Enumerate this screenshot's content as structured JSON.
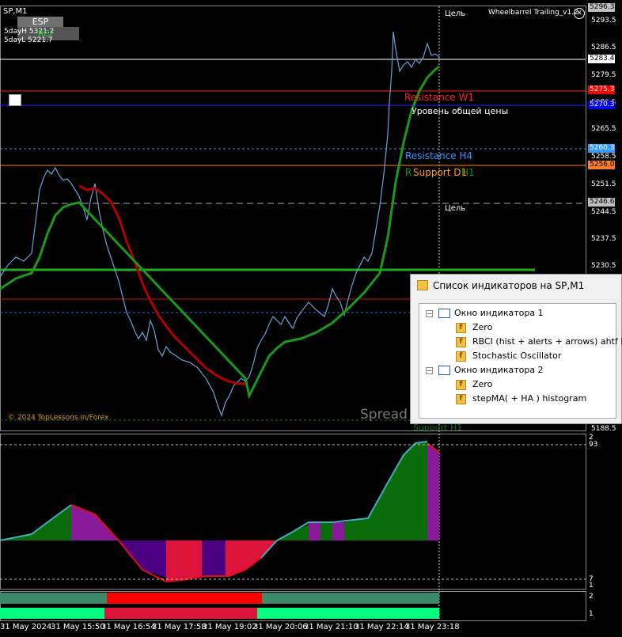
{
  "chart": {
    "symbol": "SP,M1",
    "indicator_name": "Wheelbarrel Trailing_v1.2",
    "day_high": "5dayH 5321.2",
    "day_low": "5dayL 5221.7",
    "esp_label": "ESP",
    "rci_label": "RCI",
    "watermark": "Spread",
    "copyright": "© 2024 TopLessons.In/Forex"
  },
  "levels": {
    "target_top": "Цель",
    "resistance_w1": "Resistance W1",
    "common_level": "Уровень общей цены",
    "resistance_h4": "Resistance H4",
    "support_d1": "Support D1",
    "r_h1_overlap": "R",
    "r_h1_suffix": "H1",
    "target_mid": "Цель",
    "support_h1": "Support H1"
  },
  "price_axis": {
    "ticks": [
      "5293.5",
      "5286.5",
      "5279.5",
      "5272.5",
      "5265.5",
      "5258.5",
      "5251.5",
      "5244.5",
      "5237.5",
      "5230.5",
      "5188.5"
    ],
    "tags": [
      {
        "text": "5296.3",
        "bg": "#c0c0c0",
        "fg": "#000000"
      },
      {
        "text": "5283.4",
        "bg": "#ffffff",
        "fg": "#000000"
      },
      {
        "text": "5275.3",
        "bg": "#ff0000",
        "fg": "#ffffff"
      },
      {
        "text": "5270.3",
        "bg": "#0000ff",
        "fg": "#ffffff"
      },
      {
        "text": "5260.3",
        "bg": "#3399ff",
        "fg": "#ffffff"
      },
      {
        "text": "5256.0",
        "bg": "#ff7f27",
        "fg": "#000000"
      },
      {
        "text": "5246.6",
        "bg": "#c0c0c0",
        "fg": "#000000"
      }
    ]
  },
  "sub1_axis": {
    "top": "2",
    "top2": "93",
    "bottom2": "7",
    "bottom": "1"
  },
  "sub2_axis": {
    "top": "2",
    "bottom": "1"
  },
  "time_axis": [
    "31 May 2024",
    "31 May 15:50",
    "31 May 16:54",
    "31 May 17:58",
    "31 May 19:02",
    "31 May 20:06",
    "31 May 21:10",
    "31 May 22:14",
    "31 May 23:18"
  ],
  "dialog": {
    "title": "Список индикаторов на SP,M1",
    "items": [
      {
        "label": "Окно индикатора 1",
        "type": "window"
      },
      {
        "label": "Zero",
        "type": "indicator"
      },
      {
        "label": "RBCI (hist + alerts + arrows) ahtf BT",
        "type": "indicator"
      },
      {
        "label": "Stochastic Oscillator",
        "type": "indicator"
      },
      {
        "label": "Окно индикатора 2",
        "type": "window"
      },
      {
        "label": "Zero",
        "type": "indicator"
      },
      {
        "label": "stepMA( + HA ) histogram",
        "type": "indicator"
      }
    ]
  },
  "colors": {
    "background": "#000000",
    "price_line": "#6f9fd8",
    "ma_red": "#b00000",
    "ma_green": "#1a9a1a",
    "resistance": "#ff0000",
    "support": "#228b22",
    "histo_green": "#0a6b0a",
    "histo_purple": "#8b1a9b",
    "histo_red": "#dc143c",
    "histo_indigo": "#4b0082",
    "bar_teal": "#3a8a6a",
    "bar_red": "#ff0000",
    "bar_spring": "#00ff7f",
    "bar_crimson": "#dc143c"
  }
}
